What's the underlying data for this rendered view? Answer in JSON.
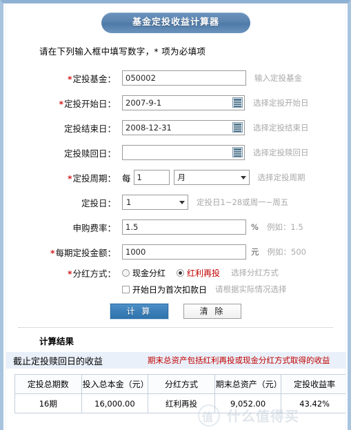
{
  "header": {
    "title": "基金定投收益计算器",
    "subtitle": "请在下列输入框中填写数字，* 项为必填项"
  },
  "form": {
    "rows": [
      {
        "label": "定投基金：",
        "required": true,
        "value": "050002",
        "hint": "输入定投基金"
      },
      {
        "label": "定投开始日：",
        "required": true,
        "value": "2007-9-1",
        "hint": "选择定投开始日",
        "icon": "calendar-icon"
      },
      {
        "label": "定投结束日：",
        "required": false,
        "value": "2008-12-31",
        "hint": "选择定投结束日",
        "icon": "calendar-icon"
      },
      {
        "label": "定投赎回日：",
        "required": false,
        "value": "",
        "hint": "选择定投赎回日",
        "icon": "calendar-icon"
      },
      {
        "label": "定投周期：",
        "required": true,
        "prefix": "每",
        "value": "1",
        "select_value": "月",
        "hint": "选择定投周期"
      },
      {
        "label": "定投日：",
        "required": false,
        "select_value": "1",
        "hint": "定投日1~28或周一~周五"
      },
      {
        "label": "申购费率：",
        "required": false,
        "value": "1.5",
        "unit": "%",
        "hint": "例如：1.5"
      },
      {
        "label": "每期定投金额：",
        "required": true,
        "value": "1000",
        "unit": "元",
        "hint": "例如：500"
      },
      {
        "label": "分红方式：",
        "required": true,
        "hint": "选择分红方式"
      }
    ],
    "dividend": {
      "option_cash": "现金分红",
      "option_reinvest": "红利再投",
      "selected": "红利再投",
      "hint": "选择分红方式",
      "checkbox_label": "开始日为首次扣款日",
      "checkbox_hint": "请根据实际情况选择",
      "checkbox_checked": false
    },
    "buttons": {
      "calculate": "计 算",
      "clear": "清 除"
    }
  },
  "results": {
    "title": "计算结果",
    "band_left": "截止定投赎回日的收益",
    "band_right": "期末总资产包括红利再投或现金分红方式取得的收益",
    "table": {
      "headers": [
        "定投总期数",
        "投入总本金（元）",
        "分红方式",
        "期末总资产（元）",
        "定投收益率"
      ],
      "rows": [
        [
          "16期",
          "16,000.00",
          "红利再投",
          "9,052.00",
          "43.42%"
        ]
      ]
    }
  },
  "watermark": {
    "mark": "值",
    "text": "什么值得买"
  },
  "colors": {
    "accent": "#4f7aa8",
    "required": "#d02020",
    "alert": "#c00000",
    "band": "#eaf0f9"
  }
}
